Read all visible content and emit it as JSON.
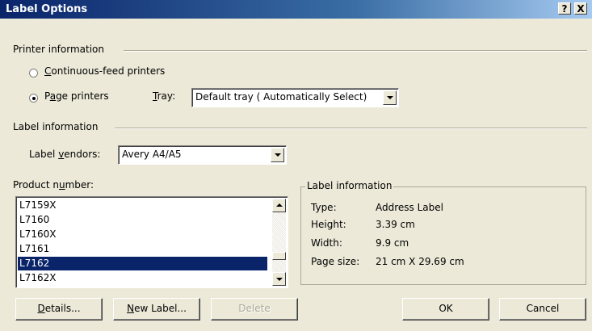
{
  "window": {
    "title": "Label Options",
    "help_label": "?",
    "close_label": "X"
  },
  "printer_info": {
    "heading": "Printer information",
    "continuous_label": "Continuous-feed printers",
    "page_printers_label": "Page printers",
    "selected": "page_printers",
    "tray_label": "Tray:",
    "tray_value": "Default tray ( Automatically Select)"
  },
  "label_info": {
    "heading": "Label information",
    "vendors_label": "Label vendors:",
    "vendors_value": "Avery A4/A5"
  },
  "product": {
    "label": "Product number:",
    "items": [
      "L7159X",
      "L7160",
      "L7160X",
      "L7161",
      "L7162",
      "L7162X"
    ],
    "selected_index": 4
  },
  "info_panel": {
    "legend": "Label information",
    "type_key": "Type:",
    "type_val": "Address Label",
    "height_key": "Height:",
    "height_val": "3.39 cm",
    "width_key": "Width:",
    "width_val": "9.9 cm",
    "page_key": "Page size:",
    "page_val": "21 cm X 29.69 cm"
  },
  "buttons": {
    "details": "Details...",
    "new_label": "New Label...",
    "delete": "Delete",
    "ok": "OK",
    "cancel": "Cancel"
  },
  "colors": {
    "title_bar": "#0a246a",
    "selection": "#0a246a",
    "dialog_bg": "#ece9d8"
  }
}
